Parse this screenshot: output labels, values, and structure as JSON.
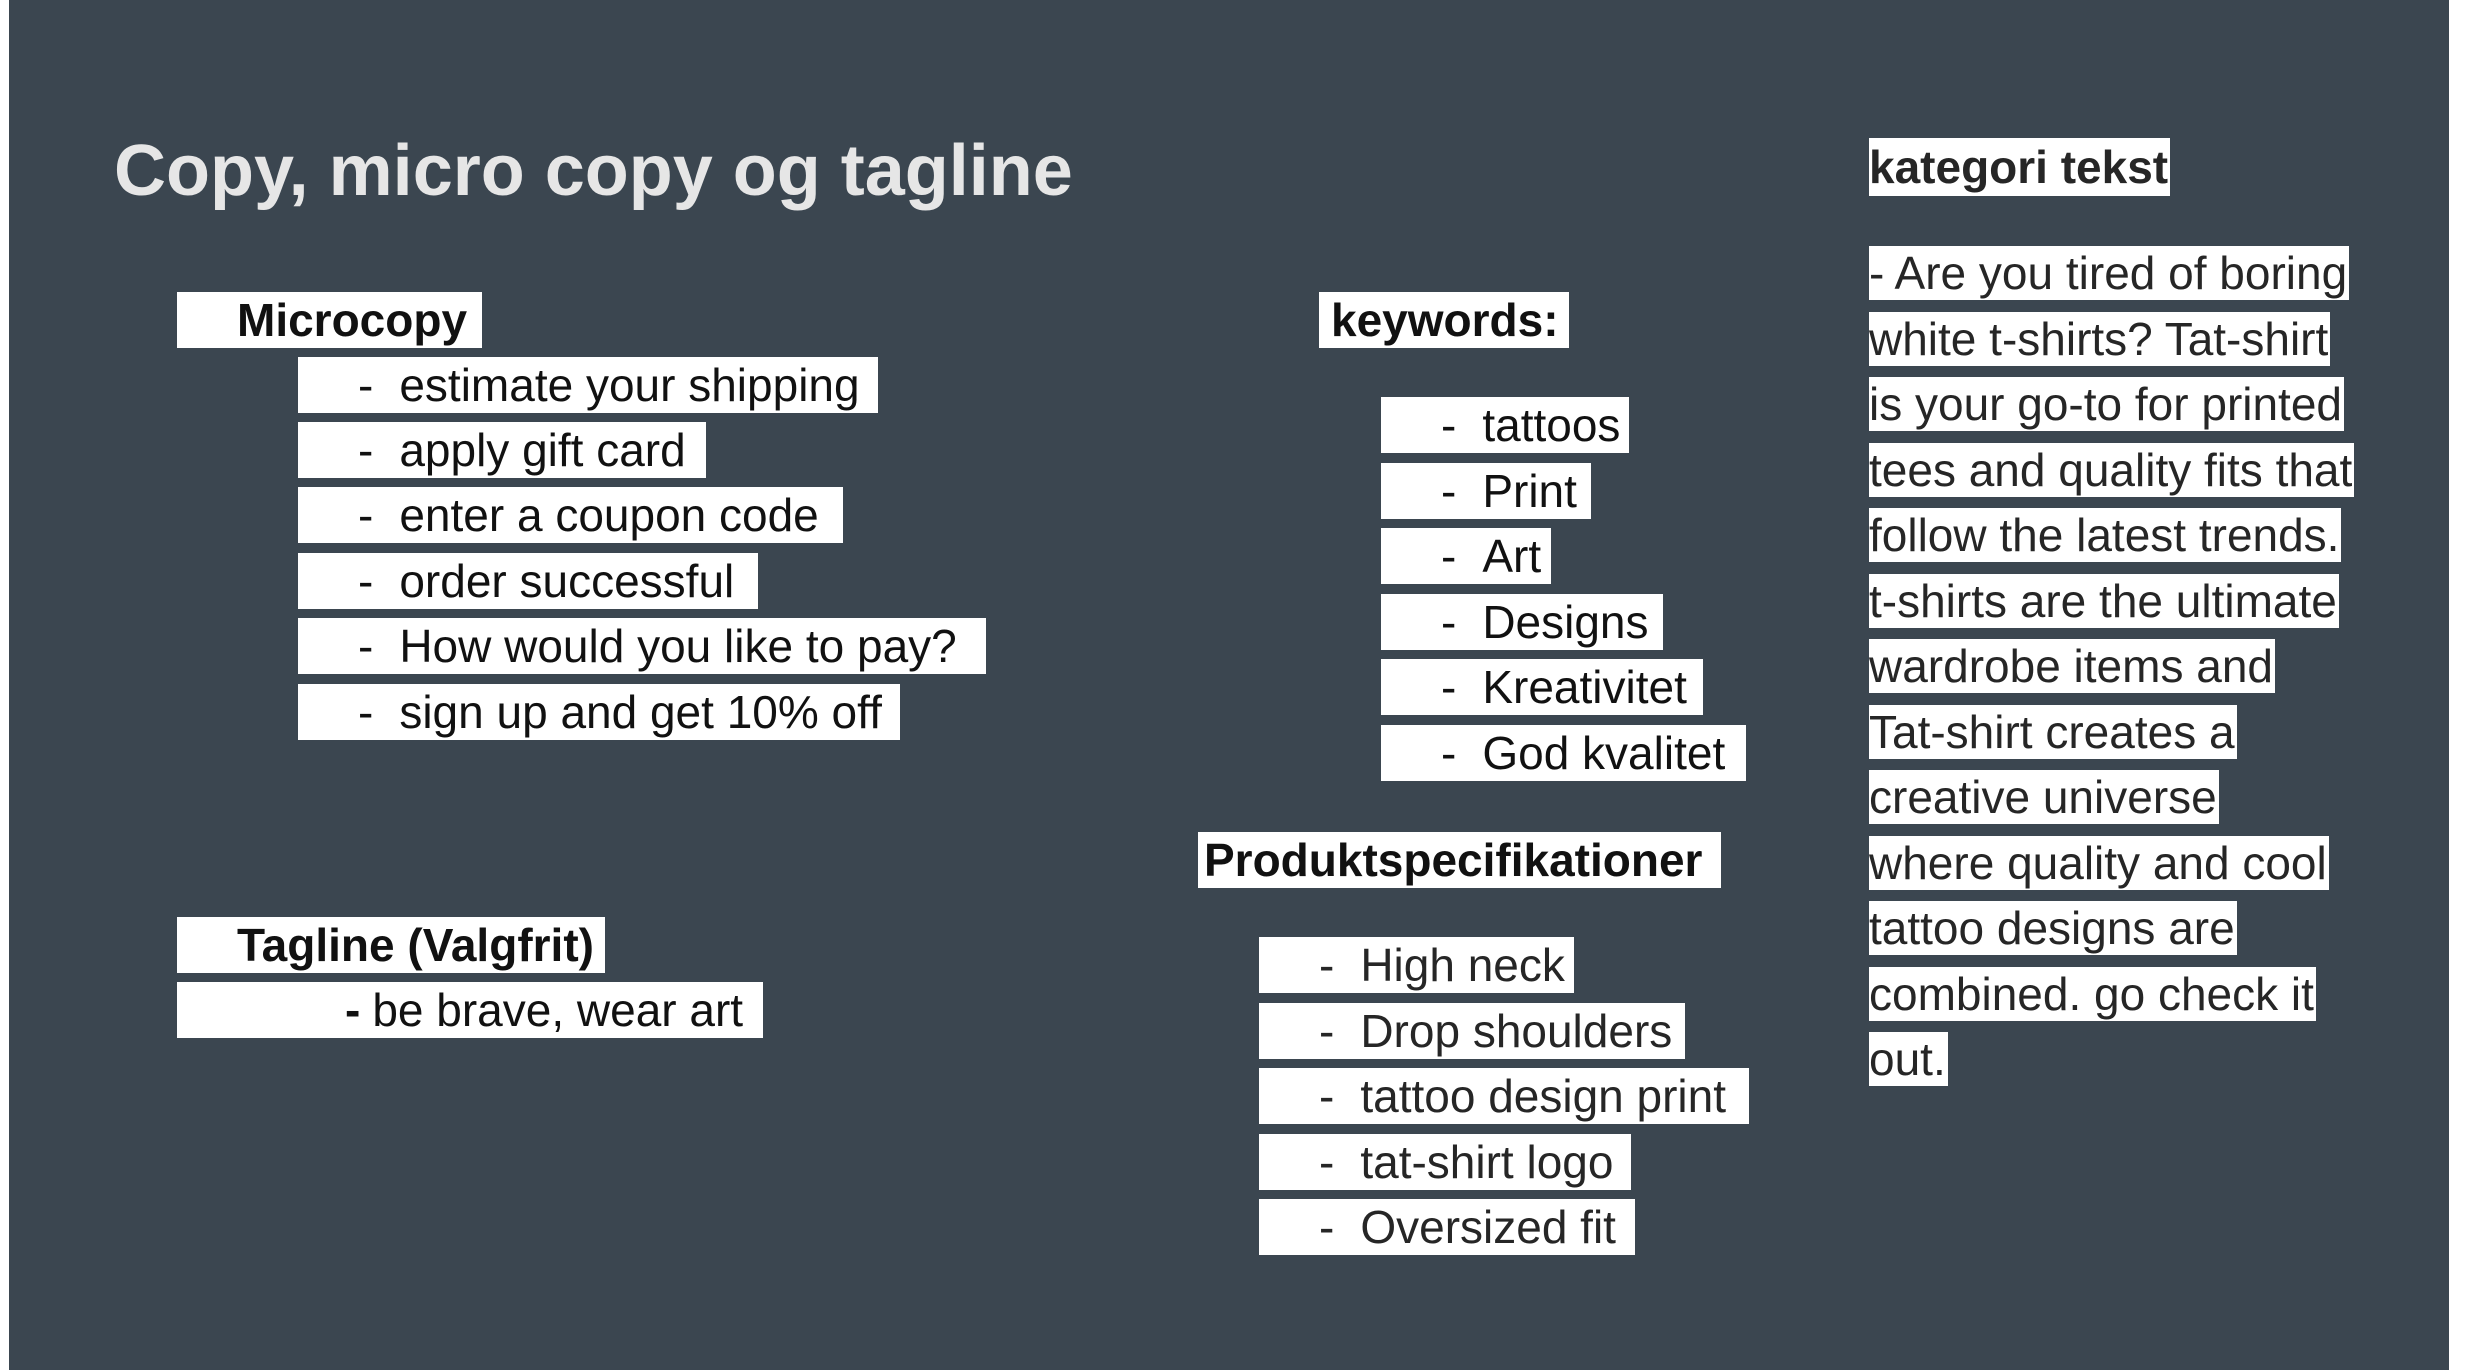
{
  "slide": {
    "title": "Copy, micro copy og tagline"
  },
  "microcopy": {
    "heading": "Microcopy",
    "dash": "-",
    "items": [
      "estimate your shipping",
      "apply gift card",
      "enter a coupon code",
      "order successful",
      "How would you like to pay?",
      "sign up and get 10% off"
    ]
  },
  "tagline": {
    "heading": "Tagline (Valgfrit)",
    "dash": "-",
    "text": "be brave, wear art"
  },
  "keywords": {
    "heading": "keywords:",
    "dash": "-",
    "items": [
      "tattoos",
      "Print",
      "Art",
      "Designs",
      "Kreativitet",
      "God kvalitet"
    ]
  },
  "specs": {
    "heading": "Produktspecifikationer",
    "dash": "-",
    "items": [
      "High neck",
      "Drop shoulders",
      "tattoo design print",
      "tat-shirt logo",
      "Oversized fit"
    ]
  },
  "kategori": {
    "heading": "kategori tekst",
    "lines": [
      "- Are you tired of boring",
      "white t-shirts? Tat-shirt",
      "is your go-to for printed",
      "tees and quality fits that",
      "follow the latest trends.",
      "t-shirts are the ultimate",
      "wardrobe items and",
      "Tat-shirt creates a",
      "creative universe",
      "where quality and cool",
      "tattoo designs are",
      "combined. go check it",
      "out."
    ]
  }
}
